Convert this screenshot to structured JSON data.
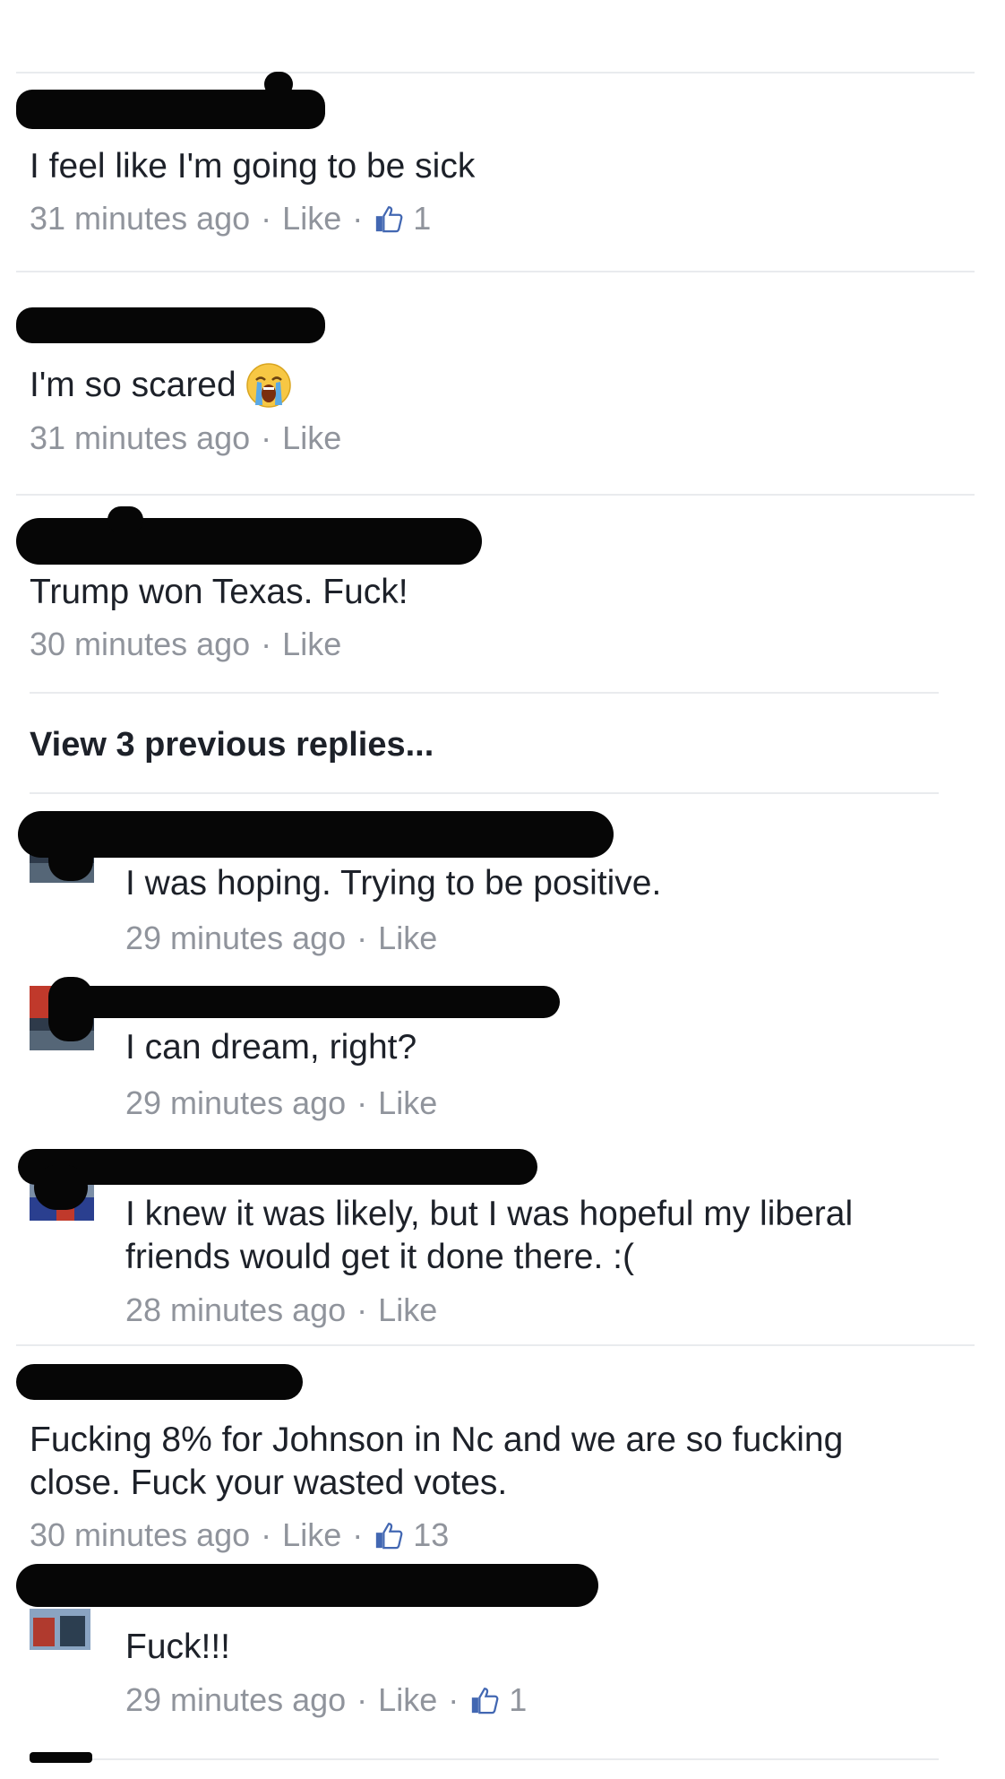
{
  "comments": [
    {
      "text": "I feel like I'm going to be sick",
      "time": "31 minutes ago",
      "like": "Like",
      "likes": "1"
    },
    {
      "text": "I'm so scared",
      "emoji": "loudly-crying-face",
      "time": "31 minutes ago",
      "like": "Like"
    },
    {
      "text": "Trump won Texas.  Fuck!",
      "time": "30 minutes ago",
      "like": "Like"
    }
  ],
  "view_previous": "View 3 previous replies...",
  "replies": [
    {
      "text": "I was hoping.  Trying to be positive.",
      "time": "29 minutes ago",
      "like": "Like"
    },
    {
      "text": "I can dream,  right?",
      "time": "29 minutes ago",
      "like": "Like"
    },
    {
      "text_line1": "I knew it was likely, but I was hopeful my liberal",
      "text_line2": "friends would get it done there. :(",
      "time": "28 minutes ago",
      "like": "Like"
    }
  ],
  "comments2": [
    {
      "text_line1": "Fucking 8% for Johnson in Nc and we are so fucking",
      "text_line2": "close. Fuck your wasted votes.",
      "time": "30 minutes ago",
      "like": "Like",
      "likes": "13"
    }
  ],
  "replies2": [
    {
      "text": "Fuck!!!",
      "time": "29 minutes ago",
      "like": "Like",
      "likes": "1"
    }
  ],
  "colors": {
    "text": "#1d2129",
    "meta": "#90949c",
    "thumb": "#4267b2",
    "divider": "#e9ebee",
    "redaction": "#060606"
  },
  "icons": [
    "thumbs-up-icon",
    "loudly-crying-face-emoji"
  ]
}
